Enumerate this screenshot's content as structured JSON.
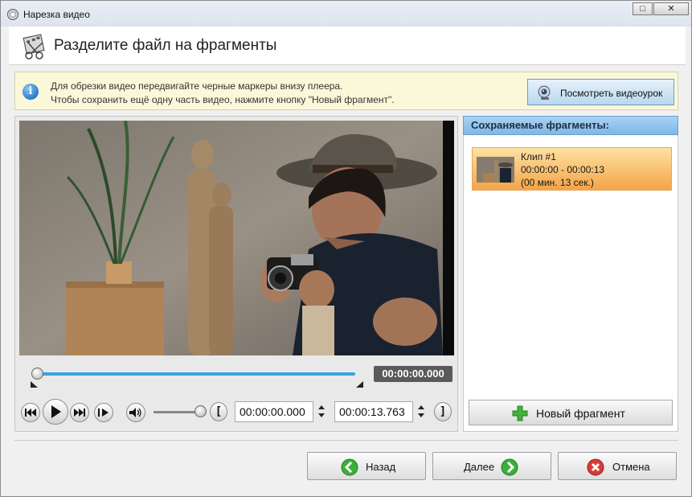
{
  "window": {
    "title": "Нарезка видео",
    "maximize_glyph": "□",
    "close_glyph": "✕"
  },
  "header": {
    "title": "Разделите файл на фрагменты",
    "icon": "film-scissors-icon"
  },
  "info": {
    "icon": "info-icon",
    "line1": "Для обрезки видео передвигайте черные маркеры внизу плеера.",
    "line2": "Чтобы сохранить ещё одну часть видео, нажмите кнопку \"Новый фрагмент\".",
    "tutorial_label": "Посмотреть видеоурок"
  },
  "player": {
    "current_time": "00:00:00.000",
    "position_fraction": 0.0,
    "volume_fraction": 1.0,
    "start_label": "[",
    "end_label": "]",
    "start_time": "00:00:00.000",
    "end_time": "00:00:13.763"
  },
  "fragments": {
    "header": "Сохраняемые фрагменты:",
    "items": [
      {
        "title": "Клип #1",
        "range": "00:00:00 - 00:00:13",
        "duration": "(00 мин. 13 сек.)"
      }
    ],
    "new_fragment_label": "Новый фрагмент"
  },
  "footer": {
    "back_label": "Назад",
    "next_label": "Далее",
    "cancel_label": "Отмена"
  },
  "colors": {
    "accent_blue": "#3aa3e0",
    "clip_selected": "#f4a447",
    "info_bg": "#fbf8da",
    "green": "#3bb03b",
    "red": "#d93a3a"
  }
}
